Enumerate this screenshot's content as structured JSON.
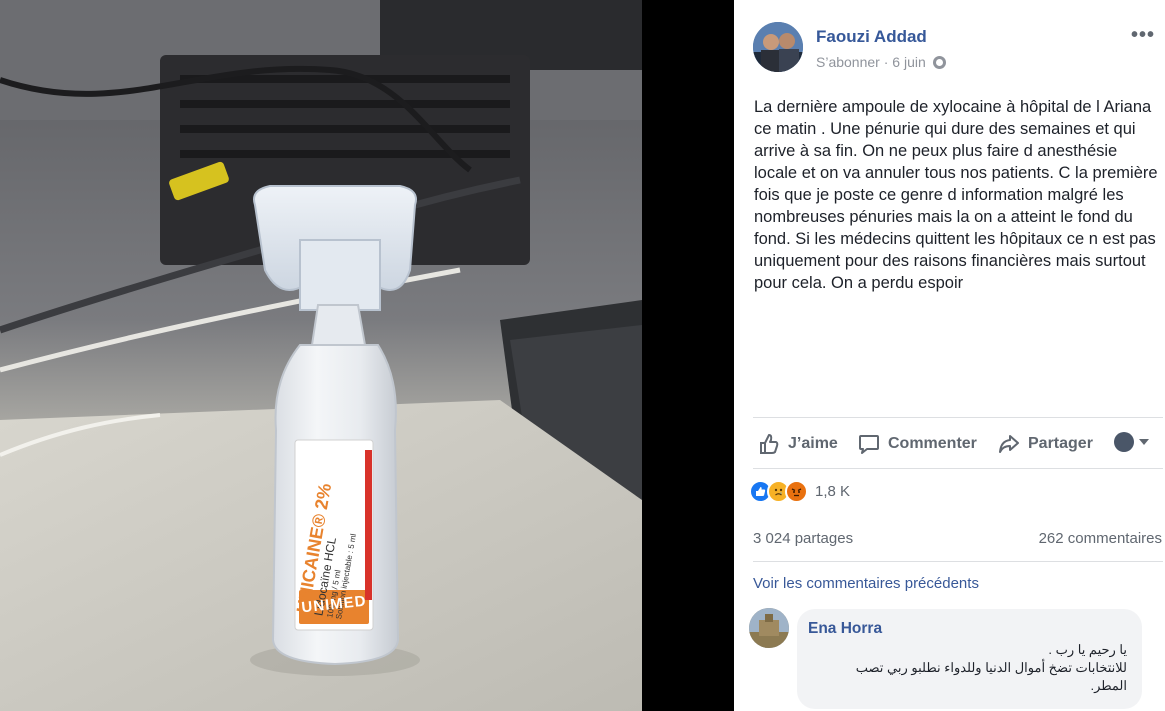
{
  "post": {
    "author": "Faouzi Addad",
    "follow_label": "S’abonner",
    "separator": " · ",
    "date": "6 juin",
    "more_label": "•••",
    "text": "La dernière ampoule de xylocaine à hôpital de l Ariana ce matin . Une pénurie qui dure des semaines et qui arrive à sa fin. On ne peux plus faire d anesthésie locale et on va annuler tous nos patients. C la première fois que je poste ce genre d information malgré les nombreuses pénuries mais la on a atteint le fond du fond. Si les médecins quittent les hôpitaux ce n est pas uniquement pour des raisons financières mais surtout pour cela. On a perdu espoir"
  },
  "actions": {
    "like": "J’aime",
    "comment": "Commenter",
    "share": "Partager"
  },
  "reactions": {
    "icons": [
      "like-reaction",
      "sad-reaction",
      "angry-reaction"
    ],
    "count": "1,8 K"
  },
  "stats": {
    "shares": "3 024 partages",
    "comments": "262 commentaires"
  },
  "prev_comments_link": "Voir les commentaires précédents",
  "comment": {
    "author": "Ena Horra",
    "line1": "يا رحيم يا رب .",
    "line2": "للانتخابات تضخ أموال الدنيا وللدواء نطلبو ربي تصب",
    "line3": "المطر."
  },
  "photo": {
    "label_brand": "UNICAINE",
    "label_percent": "2%",
    "label_generic": "Lidocaïne HCL",
    "label_dose": "100 mg / 5 ml",
    "label_solution": "Solution injectable : 5 ml",
    "label_maker": "UNIMED"
  },
  "colors": {
    "link": "#385898",
    "author": "#365899",
    "text": "#1d2129",
    "muted": "#606770",
    "like_blue": "#1877f2",
    "label_orange": "#e8832e"
  }
}
